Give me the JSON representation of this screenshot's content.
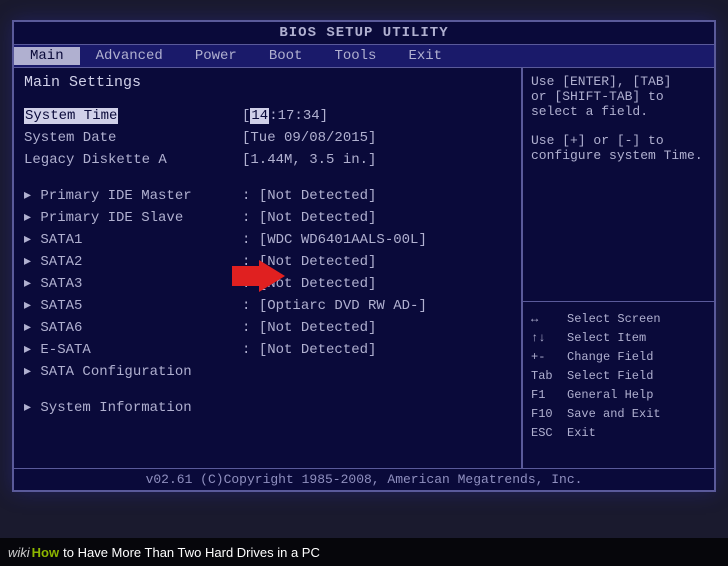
{
  "title": "BIOS SETUP UTILITY",
  "menu": [
    "Main",
    "Advanced",
    "Power",
    "Boot",
    "Tools",
    "Exit"
  ],
  "activeMenu": 0,
  "sectionTitle": "Main Settings",
  "basic": [
    {
      "label": "System Time",
      "value": "[14:17:34]",
      "labelHL": true,
      "valuePartHL": "14"
    },
    {
      "label": "System Date",
      "value": "[Tue 09/08/2015]"
    },
    {
      "label": "Legacy Diskette A",
      "value": "[1.44M, 3.5 in.]"
    }
  ],
  "devices": [
    {
      "label": "Primary IDE Master",
      "value": "[Not Detected]"
    },
    {
      "label": "Primary IDE Slave",
      "value": "[Not Detected]"
    },
    {
      "label": "SATA1",
      "value": "[WDC WD6401AALS-00L]"
    },
    {
      "label": "SATA2",
      "value": "[Not Detected]"
    },
    {
      "label": "SATA3",
      "value": "[Not Detected]"
    },
    {
      "label": "SATA5",
      "value": "[Optiarc DVD RW AD-]"
    },
    {
      "label": "SATA6",
      "value": "[Not Detected]"
    },
    {
      "label": "E-SATA",
      "value": "[Not Detected]"
    },
    {
      "label": "SATA Configuration",
      "value": ""
    }
  ],
  "extra": [
    {
      "label": "System Information"
    }
  ],
  "helpTop": [
    "Use [ENTER], [TAB]",
    "or [SHIFT-TAB] to",
    "select a field.",
    "",
    "Use [+] or [-] to",
    "configure system Time."
  ],
  "helpKeys": [
    {
      "k": "↔",
      "v": "Select Screen"
    },
    {
      "k": "↑↓",
      "v": "Select Item"
    },
    {
      "k": "+-",
      "v": "Change Field"
    },
    {
      "k": "Tab",
      "v": "Select Field"
    },
    {
      "k": "F1",
      "v": "General Help"
    },
    {
      "k": "F10",
      "v": "Save and Exit"
    },
    {
      "k": "ESC",
      "v": "Exit"
    }
  ],
  "footer": "v02.61 (C)Copyright 1985-2008, American Megatrends, Inc.",
  "caption": {
    "wiki": "wiki",
    "how": "How",
    "text": " to Have More Than Two Hard Drives in a PC"
  }
}
